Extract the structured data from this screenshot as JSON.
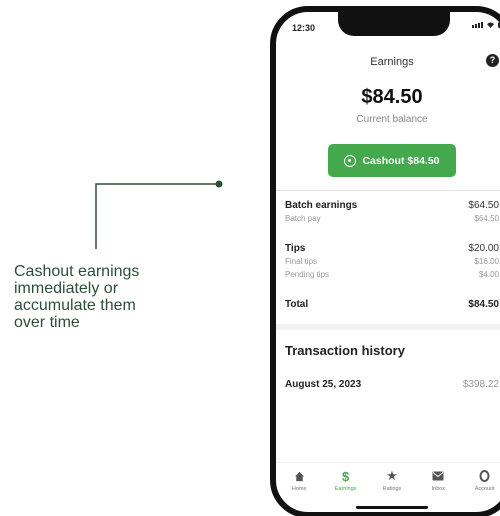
{
  "callout": {
    "line1": "Cashout earnings",
    "line2": "immediately or",
    "line3": "accumulate them",
    "line4": "over time"
  },
  "status_bar": {
    "time": "12:30"
  },
  "header": {
    "title": "Earnings"
  },
  "balance": {
    "amount": "$84.50",
    "label": "Current balance"
  },
  "cashout_button": {
    "label": "Cashout $84.50"
  },
  "breakdown": {
    "batch": {
      "label": "Batch earnings",
      "value": "$64.50",
      "sub_label": "Batch pay",
      "sub_value": "$64.50"
    },
    "tips": {
      "label": "Tips",
      "value": "$20.00",
      "items": [
        {
          "label": "Final tips",
          "value": "$16.00"
        },
        {
          "label": "Pending tips",
          "value": "$4.00"
        }
      ]
    },
    "total": {
      "label": "Total",
      "value": "$84.50"
    }
  },
  "transactions": {
    "title": "Transaction history",
    "rows": [
      {
        "date": "August 25, 2023",
        "amount": "$398.22"
      }
    ]
  },
  "tabs": [
    {
      "label": "Home",
      "icon": "home-icon",
      "active": false
    },
    {
      "label": "Earnings",
      "icon": "dollar-icon",
      "active": true
    },
    {
      "label": "Ratings",
      "icon": "star-icon",
      "active": false
    },
    {
      "label": "Inbox",
      "icon": "inbox-icon",
      "active": false
    },
    {
      "label": "Account",
      "icon": "account-icon",
      "active": false
    }
  ],
  "colors": {
    "accent": "#44a84c",
    "callout_text": "#2d4f3a"
  }
}
